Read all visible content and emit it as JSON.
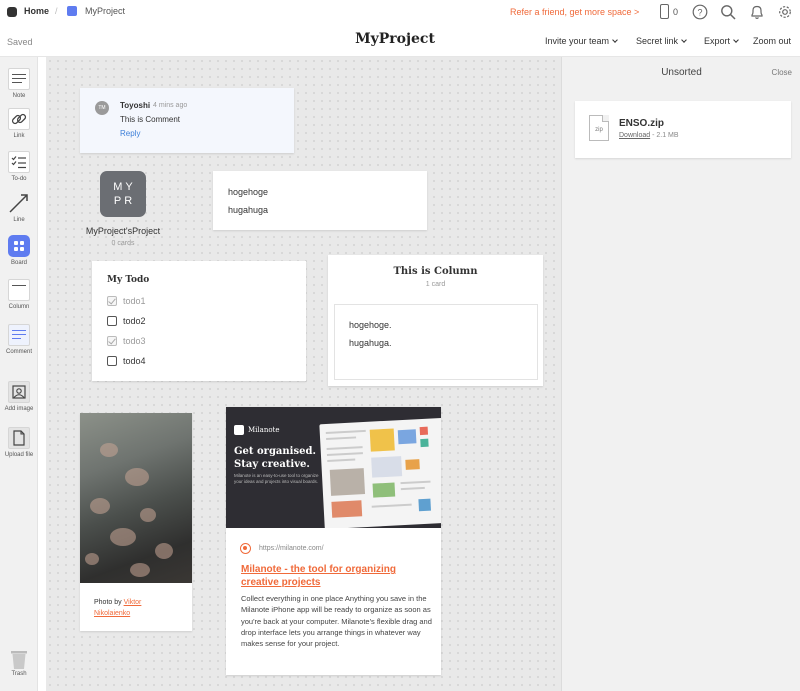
{
  "topbar": {
    "home_label": "Home",
    "separator": "/",
    "project_name": "MyProject",
    "refer_text": "Refer a friend, get more space >",
    "device_count": "0"
  },
  "header": {
    "saved_status": "Saved",
    "title": "MyProject",
    "menu": {
      "invite": "Invite your team",
      "secret_link": "Secret link",
      "export": "Export",
      "zoom": "Zoom out"
    }
  },
  "toolbar": {
    "items": [
      {
        "label": "Note",
        "icon": "note-icon"
      },
      {
        "label": "Link",
        "icon": "link-icon"
      },
      {
        "label": "To-do",
        "icon": "todo-icon"
      },
      {
        "label": "Line",
        "icon": "line-icon"
      },
      {
        "label": "Board",
        "icon": "board-icon"
      },
      {
        "label": "Column",
        "icon": "column-icon"
      },
      {
        "label": "Comment",
        "icon": "comment-icon"
      },
      {
        "label": "Add image",
        "icon": "image-icon"
      },
      {
        "label": "Upload file",
        "icon": "file-icon"
      },
      {
        "label": "Trash",
        "icon": "trash-icon"
      }
    ]
  },
  "comment": {
    "initials": "TM",
    "author": "Toyoshi",
    "time": "4 mins ago",
    "text": "This is Comment",
    "reply": "Reply"
  },
  "board": {
    "tile_line1": "MY",
    "tile_line2": "PR",
    "name": "MyProject'sProject",
    "count": "0 cards",
    "color": "#6b6e73"
  },
  "note": {
    "line1": "hogehoge",
    "line2": "hugahuga"
  },
  "todo": {
    "title": "My Todo",
    "items": [
      {
        "text": "todo1",
        "done": true
      },
      {
        "text": "todo2",
        "done": false
      },
      {
        "text": "todo3",
        "done": true
      },
      {
        "text": "todo4",
        "done": false
      }
    ]
  },
  "column": {
    "title": "This is Column",
    "count": "1 card",
    "note_line1": "hogehoge.",
    "note_line2": "hugahuga."
  },
  "photo": {
    "caption_prefix": "Photo by",
    "author_first": "Viktor",
    "author_last": "Nikolaienko"
  },
  "link_card": {
    "hero_brand": "Milanote",
    "hero_heading_line1": "Get organised.",
    "hero_heading_line2": "Stay creative.",
    "hero_sub": "Milanote is an easy-to-use tool to organize your ideas and projects into visual boards.",
    "url": "https://milanote.com/",
    "title": "Milanote - the tool for organizing creative projects",
    "description": "Collect everything in one place Anything you save in the Milanote iPhone app will be ready to organize as soon as you're back at your computer. Milanote's flexible drag and drop interface lets you arrange things in whatever way makes sense for your project."
  },
  "right_panel": {
    "title": "Unsorted",
    "close": "Close",
    "file": {
      "ext": "zip",
      "name": "ENSO.zip",
      "download": "Download",
      "size": "- 2.1 MB"
    }
  },
  "colors": {
    "accent": "#f06a3a",
    "board_blue": "#5f7cf0",
    "reply_blue": "#3d7fd8"
  }
}
